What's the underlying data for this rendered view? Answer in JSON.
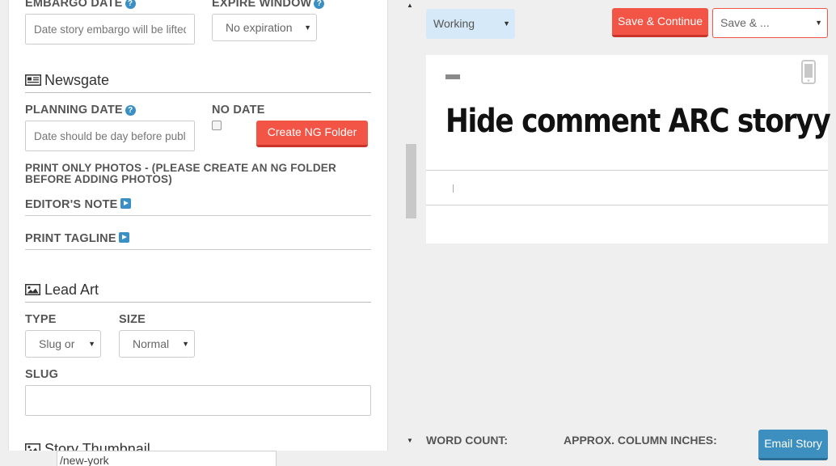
{
  "left": {
    "embargo_date": {
      "label": "EMBARGO DATE",
      "placeholder": "Date story embargo will be lifted"
    },
    "expire_window": {
      "label": "EXPIRE WINDOW",
      "value": "No expiration"
    },
    "newsgate": {
      "title": "Newsgate",
      "planning_date_label": "PLANNING DATE",
      "planning_date_placeholder": "Date should be day before publication",
      "no_date_label": "NO DATE",
      "no_date_checked": false,
      "create_ng_folder_label": "Create NG Folder",
      "print_only_photos_line1": "PRINT ONLY PHOTOS - (PLEASE CREATE AN NG FOLDER",
      "print_only_photos_line2": "BEFORE ADDING PHOTOS)",
      "editors_note_label": "EDITOR'S NOTE",
      "print_tagline_label": "PRINT TAGLINE"
    },
    "lead_art": {
      "title": "Lead Art",
      "type_label": "TYPE",
      "type_value": "Slug or",
      "size_label": "SIZE",
      "size_value": "Normal",
      "slug_label": "SLUG",
      "slug_value": ""
    },
    "story_thumbnail_title": "Story Thumbnail"
  },
  "url_popup": "/new-york",
  "toolbar": {
    "status_value": "Working",
    "save_continue_label": "Save & Continue",
    "save_and_select_value": "Save & ..."
  },
  "story": {
    "headline": "Hide comment ARC storyy"
  },
  "footer": {
    "word_count_label": "WORD COUNT:",
    "column_inches_label": "APPROX. COLUMN INCHES:",
    "email_story_label": "Email Story"
  },
  "colors": {
    "accent_blue": "#3a8fc4",
    "save_red": "#f25545",
    "status_bg": "#d6e9f8",
    "email_btn": "#3d8fbf"
  }
}
